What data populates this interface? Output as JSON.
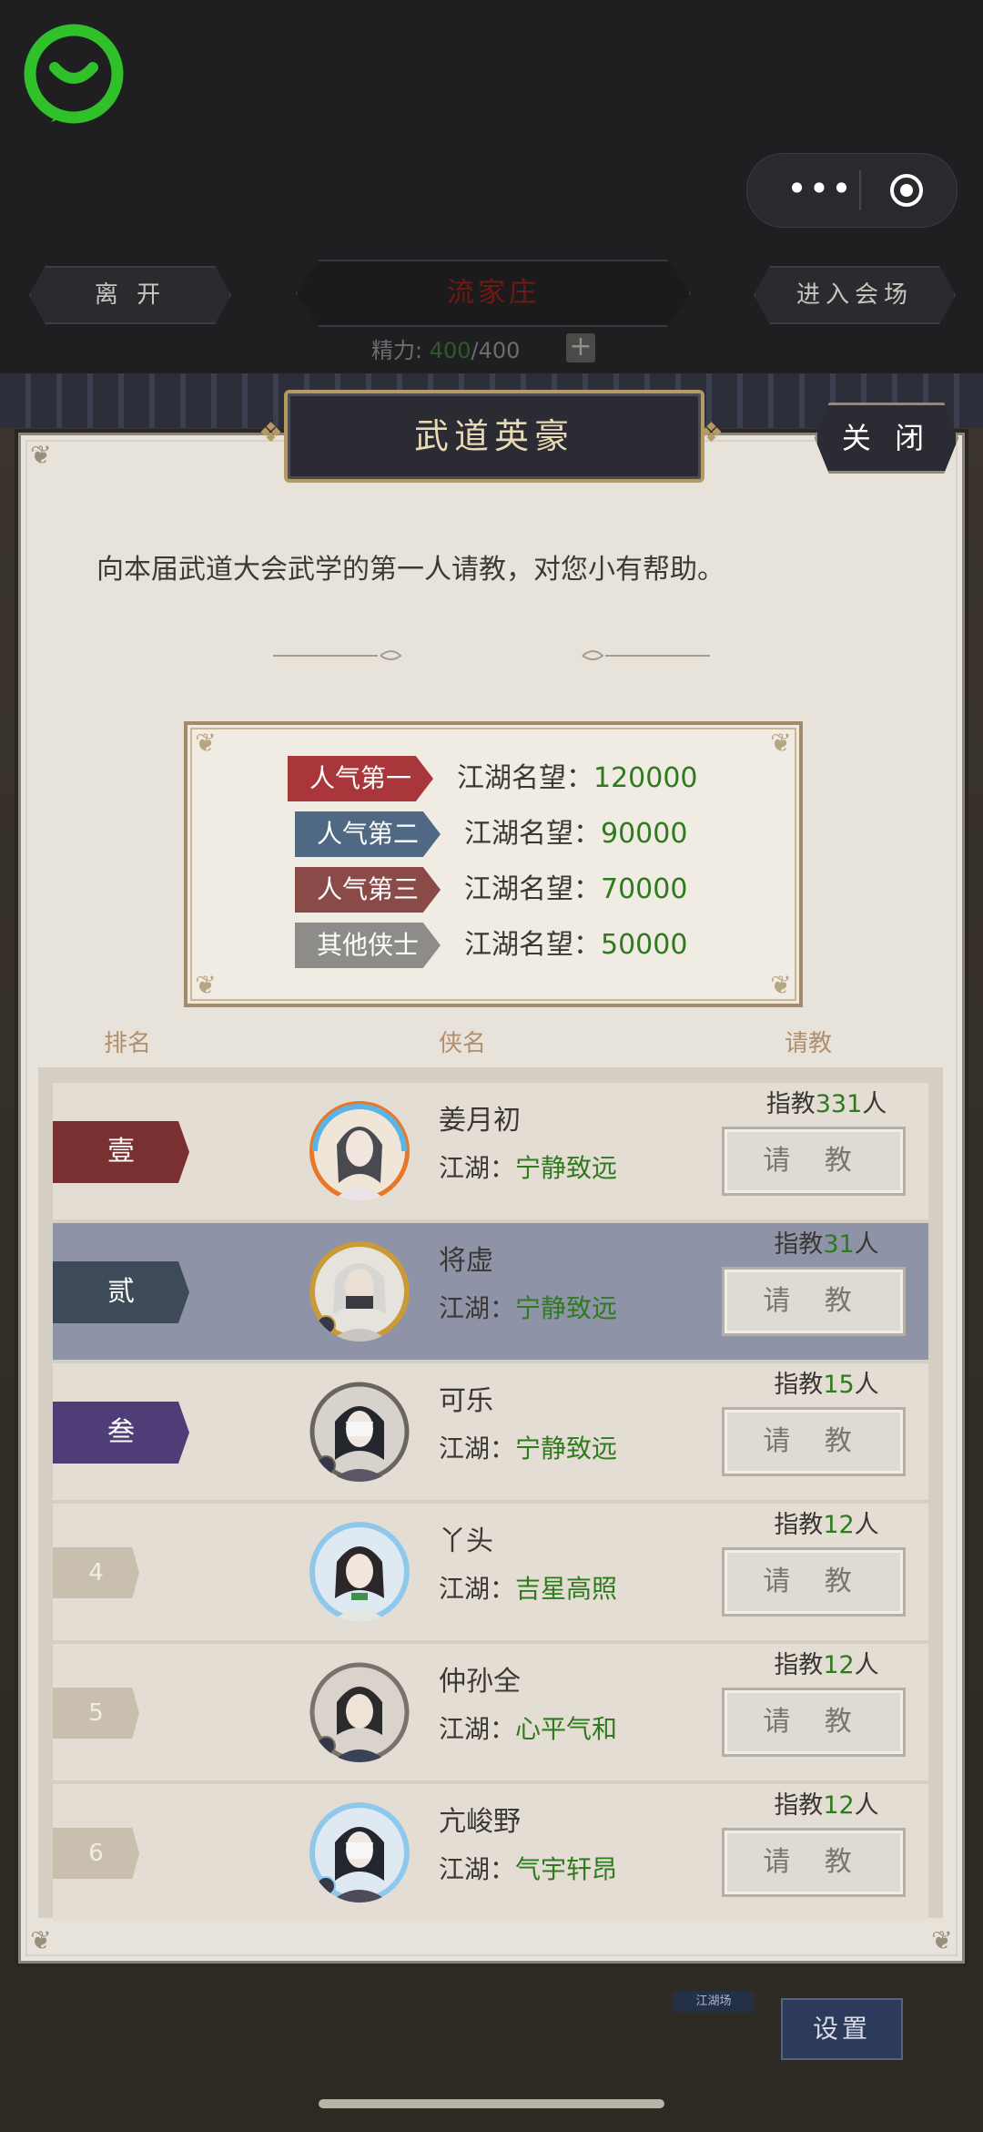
{
  "top": {
    "leave_label": "离 开",
    "location_label": "流家庄",
    "enter_label": "进入会场",
    "energy_label": "精力:",
    "energy_current": "400",
    "energy_max": "/400",
    "plus_label": "+",
    "capsule_dots": "•••"
  },
  "dialog": {
    "title": "武道英豪",
    "close_label": "关 闭",
    "intro": "向本届武道大会武学的第一人请教，对您小有帮助。",
    "rewards": [
      {
        "tag": "人气第一",
        "label": "江湖名望：",
        "value": "120000",
        "color": "#a8363a"
      },
      {
        "tag": "人气第二",
        "label": "江湖名望：",
        "value": "90000",
        "color": "#4f6985"
      },
      {
        "tag": "人气第三",
        "label": "江湖名望：",
        "value": "70000",
        "color": "#8a4a48"
      },
      {
        "tag": "其他侠士",
        "label": "江湖名望：",
        "value": "50000",
        "color": "#8d8c89"
      }
    ],
    "headers": {
      "rank": "排名",
      "name": "侠名",
      "ask": "请教"
    },
    "rows": [
      {
        "rank": "壹",
        "name": "姜月初",
        "title_label": "江湖：",
        "title": "宁静致远",
        "count_prefix": "指教",
        "count": "331",
        "count_suffix": "人",
        "button": "请 教",
        "rank_color": "#7a2f30"
      },
      {
        "rank": "贰",
        "name": "将虚",
        "title_label": "江湖：",
        "title": "宁静致远",
        "count_prefix": "指教",
        "count": "31",
        "count_suffix": "人",
        "button": "请 教",
        "rank_color": "#3f4a58"
      },
      {
        "rank": "叁",
        "name": "可乐",
        "title_label": "江湖：",
        "title": "宁静致远",
        "count_prefix": "指教",
        "count": "15",
        "count_suffix": "人",
        "button": "请 教",
        "rank_color": "#4f3d78"
      },
      {
        "rank": "4",
        "name": "丫头",
        "title_label": "江湖：",
        "title": "吉星高照",
        "count_prefix": "指教",
        "count": "12",
        "count_suffix": "人",
        "button": "请 教"
      },
      {
        "rank": "5",
        "name": "仲孙全",
        "title_label": "江湖：",
        "title": "心平气和",
        "count_prefix": "指教",
        "count": "12",
        "count_suffix": "人",
        "button": "请 教"
      },
      {
        "rank": "6",
        "name": "亢峻野",
        "title_label": "江湖：",
        "title": "气宇轩昂",
        "count_prefix": "指教",
        "count": "12",
        "count_suffix": "人",
        "button": "请 教"
      }
    ]
  },
  "background": {
    "settings_label": "设置",
    "tag_label": "江湖场"
  }
}
